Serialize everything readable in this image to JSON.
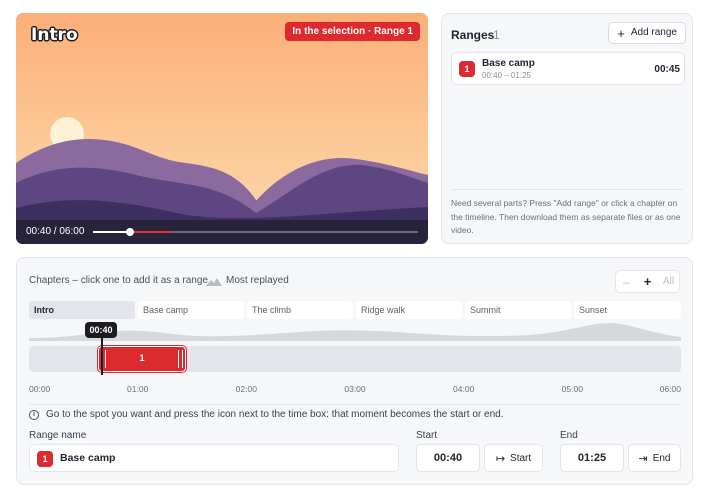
{
  "video": {
    "chapter_title": "Intro",
    "selection_badge": "In the selection · Range 1",
    "timecode": "00:40 / 06:00",
    "progress": 0.111,
    "selection_start": 0.111,
    "selection_end": 0.236
  },
  "ranges": {
    "title": "Ranges",
    "count": "1",
    "add_button": "Add range",
    "items": [
      {
        "index": "1",
        "name": "Base camp",
        "span": "00:40 – 01:25",
        "duration": "00:45"
      }
    ],
    "help": "Need several parts? Press \"Add range\" or click a chapter on the timeline. Then download them as separate files or as one video."
  },
  "timeline": {
    "hint": "Chapters – click one to add it as a range",
    "most_replayed": "Most replayed",
    "zoom": {
      "minus": "–",
      "plus": "+",
      "all": "All"
    },
    "chapters": [
      "Intro",
      "Base camp",
      "The climb",
      "Ridge walk",
      "Summit",
      "Sunset"
    ],
    "active_chapter": "Intro",
    "selection_label": "1",
    "playhead_label": "00:40",
    "ticks": [
      "00:00",
      "01:00",
      "02:00",
      "03:00",
      "04:00",
      "05:00",
      "06:00"
    ],
    "info": "Go to the spot you want and press the icon next to the time box: that moment becomes the start or end."
  },
  "editor": {
    "name_label": "Range name",
    "name_index": "1",
    "name_value": "Base camp",
    "start_label": "Start",
    "start_value": "00:40",
    "start_button": "Start",
    "end_label": "End",
    "end_value": "01:25",
    "end_button": "End"
  },
  "colors": {
    "accent": "#dc2a2f",
    "panel_bg": "#f6f7f9",
    "border": "#e3e5ea",
    "video_bar": "#27233a"
  },
  "icons": [
    "plus-icon",
    "mountain-icon",
    "info-icon",
    "set-start-icon",
    "set-end-icon"
  ]
}
